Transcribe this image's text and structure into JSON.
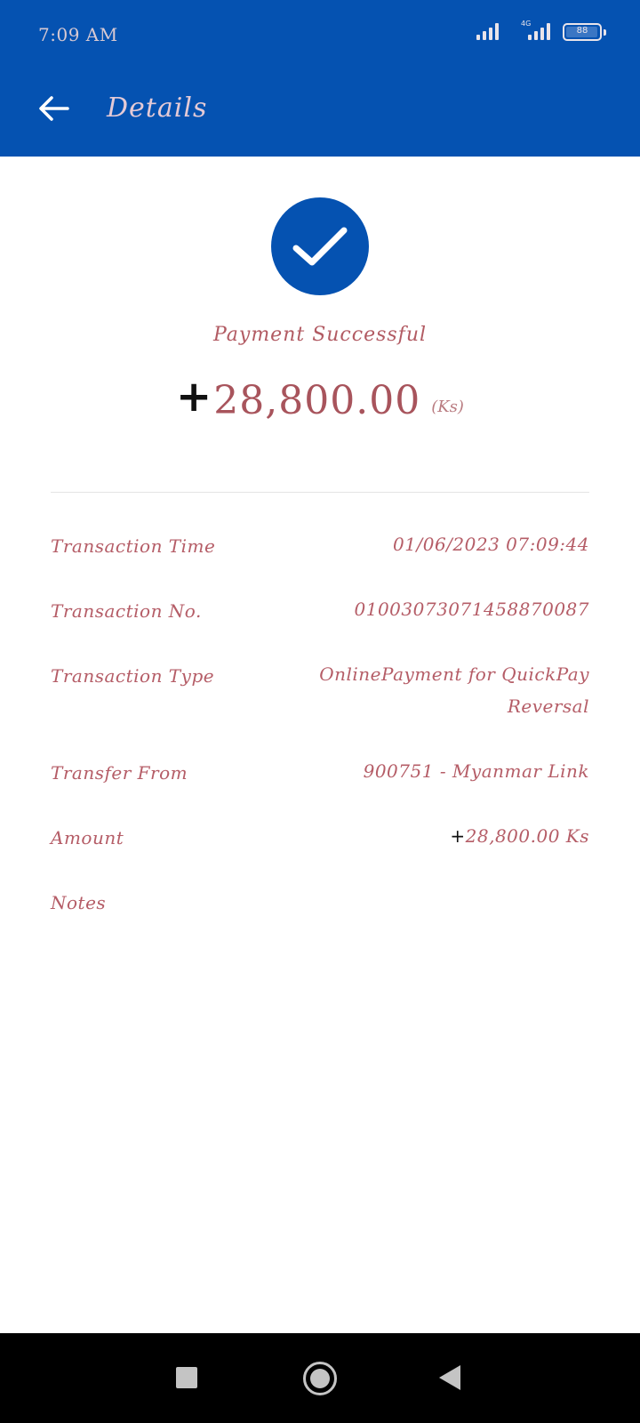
{
  "status_bar": {
    "time": "7:09 AM",
    "network_tag": "4G",
    "battery_level": "88"
  },
  "header": {
    "title": "Details",
    "back_icon": "arrow-left-icon"
  },
  "result": {
    "status_icon": "check-icon",
    "status_text": "Payment Successful",
    "amount_sign": "+",
    "amount_value": "28,800.00",
    "amount_unit": "(Ks)"
  },
  "details": [
    {
      "label": "Transaction Time",
      "value": "01/06/2023 07:09:44"
    },
    {
      "label": "Transaction No.",
      "value": "01003073071458870087"
    },
    {
      "label": "Transaction Type",
      "value": "OnlinePayment for QuickPay Reversal"
    },
    {
      "label": "Transfer From",
      "value": "900751 - Myanmar Link"
    },
    {
      "label": "Amount",
      "sign": "+",
      "value": "28,800.00 Ks"
    },
    {
      "label": "Notes",
      "value": ""
    }
  ],
  "nav_bar": {
    "recent_icon": "square-icon",
    "home_icon": "circle-icon",
    "back_icon": "triangle-back-icon"
  },
  "colors": {
    "primary": "#0552b1",
    "accent_text": "#b55d67",
    "nav_background": "#000000"
  }
}
